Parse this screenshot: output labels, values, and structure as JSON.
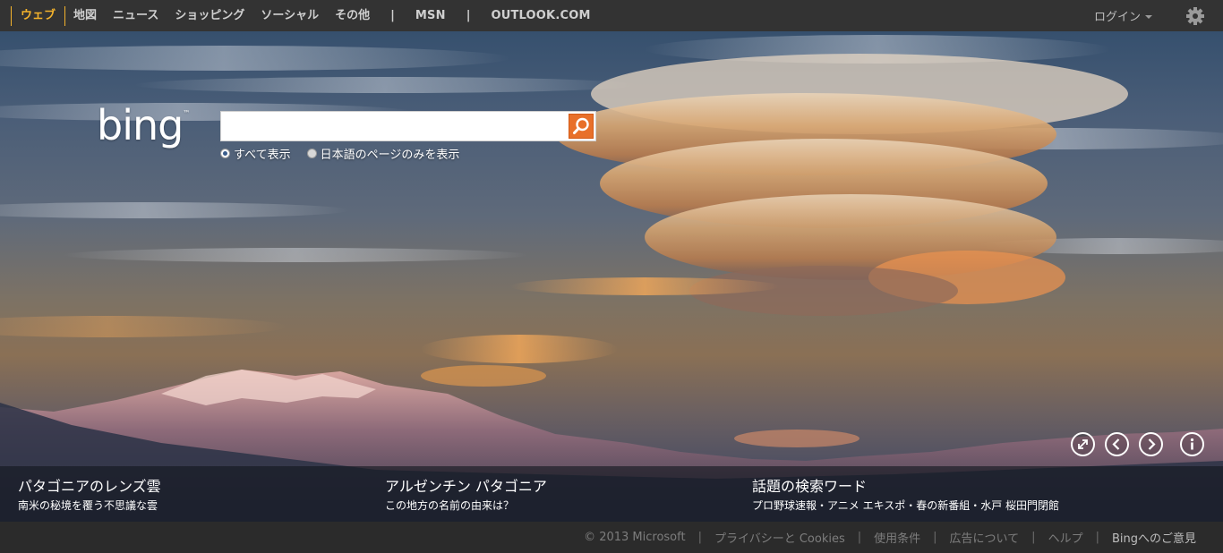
{
  "nav": {
    "items": [
      {
        "label": "ウェブ",
        "active": true
      },
      {
        "label": "地図"
      },
      {
        "label": "ニュース"
      },
      {
        "label": "ショッピング"
      },
      {
        "label": "ソーシャル"
      },
      {
        "label": "その他"
      }
    ],
    "separator": "|",
    "msn": "MSN",
    "outlook": "OUTLOOK.COM",
    "login": "ログイン"
  },
  "logo": {
    "text": "bing",
    "tm": "™"
  },
  "search": {
    "value": "",
    "options": [
      {
        "label": "すべて表示",
        "selected": true
      },
      {
        "label": "日本語のページのみを表示",
        "selected": false
      }
    ]
  },
  "hotspots": [
    {
      "title": "パタゴニアのレンズ雲",
      "subtitle": "南米の秘境を覆う不思議な雲"
    },
    {
      "title": "アルゼンチン パタゴニア",
      "subtitle": "この地方の名前の由来は？"
    },
    {
      "title": "話題の検索ワード",
      "subtitle": "プロ野球速報・アニメ エキスポ・春の新番組・水戸 桜田門閉館"
    }
  ],
  "footer": {
    "copyright": "© 2013 Microsoft",
    "links": [
      "プライバシーと Cookies",
      "使用条件",
      "広告について",
      "ヘルプ"
    ],
    "feedback": "Bingへのご意見"
  },
  "colors": {
    "nav_active": "#f4b32c",
    "search_button": "#e8702a",
    "topbar": "#333333"
  },
  "icons": [
    "gear-icon",
    "search-icon",
    "fullscreen-icon",
    "previous-icon",
    "next-icon",
    "info-icon"
  ]
}
